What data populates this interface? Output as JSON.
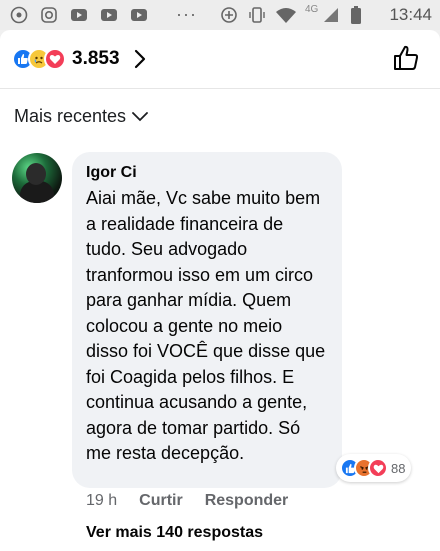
{
  "status_bar": {
    "time": "13:44",
    "network": "4G"
  },
  "header": {
    "reaction_count": "3.853",
    "reactions": [
      "like",
      "sad",
      "love"
    ]
  },
  "sort": {
    "label": "Mais recentes"
  },
  "comment": {
    "author": "Igor Ci",
    "text": "Aiai mãe, Vc sabe muito bem a realidade financeira de tudo. Seu advogado tranformou isso em um circo para ganhar mídia. Quem colocou a gente no meio disso foi VOCÊ que disse que foi Coagida pelos filhos. E continua acusando a gente, agora de tomar partido. Só me resta decepção.",
    "time": "19 h",
    "like_label": "Curtir",
    "reply_label": "Responder",
    "reaction_count": "88",
    "reactions": [
      "like",
      "angry",
      "love"
    ]
  },
  "view_more": {
    "label": "Ver mais 140 respostas"
  },
  "colors": {
    "like": "#1877f2",
    "love": "#f33e58",
    "sad": "#f7c83b",
    "angry": "#e8722e",
    "secondary_text": "#65676b",
    "bubble": "#f0f2f5"
  }
}
